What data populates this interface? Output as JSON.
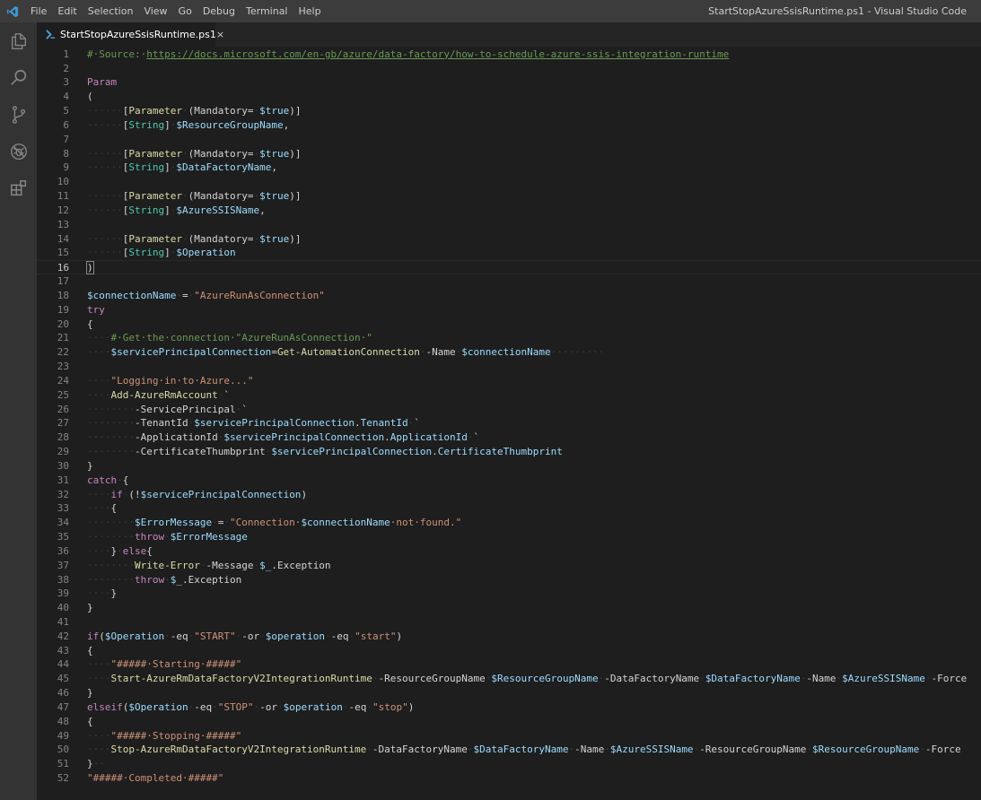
{
  "menu": [
    "File",
    "Edit",
    "Selection",
    "View",
    "Go",
    "Debug",
    "Terminal",
    "Help"
  ],
  "window_title": "StartStopAzureSsisRuntime.ps1 - Visual Studio Code",
  "activity_icons": [
    "explorer-icon",
    "search-icon",
    "source-control-icon",
    "debug-icon",
    "extensions-icon"
  ],
  "tab": {
    "label": "StartStopAzureSsisRuntime.ps1",
    "close": "×"
  },
  "current_line": 16,
  "lines": [
    {
      "n": "1",
      "t": [
        [
          "c-comment",
          "#·Source:·"
        ],
        [
          "c-link",
          "https://docs.microsoft.com/en-gb/azure/data-factory/how-to-schedule-azure-ssis-integration-runtime"
        ]
      ]
    },
    {
      "n": "2",
      "t": []
    },
    {
      "n": "3",
      "t": [
        [
          "c-kw",
          "Param"
        ]
      ]
    },
    {
      "n": "4",
      "t": [
        [
          "c-punc",
          "("
        ]
      ]
    },
    {
      "n": "5",
      "t": [
        [
          "ws",
          "······"
        ],
        [
          "c-punc",
          "["
        ],
        [
          "c-attr",
          "Parameter"
        ],
        [
          "ws",
          "·"
        ],
        [
          "c-punc",
          "("
        ],
        [
          "c-param",
          "Mandatory="
        ],
        [
          "ws",
          "·"
        ],
        [
          "c-var",
          "$true"
        ],
        [
          "c-punc",
          ")]"
        ]
      ]
    },
    {
      "n": "6",
      "t": [
        [
          "ws",
          "······"
        ],
        [
          "c-punc",
          "["
        ],
        [
          "c-type",
          "String"
        ],
        [
          "c-punc",
          "]"
        ],
        [
          "ws",
          "·"
        ],
        [
          "c-var",
          "$ResourceGroupName"
        ],
        [
          "c-punc",
          ","
        ]
      ]
    },
    {
      "n": "7",
      "t": []
    },
    {
      "n": "8",
      "t": [
        [
          "ws",
          "······"
        ],
        [
          "c-punc",
          "["
        ],
        [
          "c-attr",
          "Parameter"
        ],
        [
          "ws",
          "·"
        ],
        [
          "c-punc",
          "("
        ],
        [
          "c-param",
          "Mandatory="
        ],
        [
          "ws",
          "·"
        ],
        [
          "c-var",
          "$true"
        ],
        [
          "c-punc",
          ")]"
        ]
      ]
    },
    {
      "n": "9",
      "t": [
        [
          "ws",
          "······"
        ],
        [
          "c-punc",
          "["
        ],
        [
          "c-type",
          "String"
        ],
        [
          "c-punc",
          "]"
        ],
        [
          "ws",
          "·"
        ],
        [
          "c-var",
          "$DataFactoryName"
        ],
        [
          "c-punc",
          ","
        ]
      ]
    },
    {
      "n": "10",
      "t": []
    },
    {
      "n": "11",
      "t": [
        [
          "ws",
          "······"
        ],
        [
          "c-punc",
          "["
        ],
        [
          "c-attr",
          "Parameter"
        ],
        [
          "ws",
          "·"
        ],
        [
          "c-punc",
          "("
        ],
        [
          "c-param",
          "Mandatory="
        ],
        [
          "ws",
          "·"
        ],
        [
          "c-var",
          "$true"
        ],
        [
          "c-punc",
          ")]"
        ]
      ]
    },
    {
      "n": "12",
      "t": [
        [
          "ws",
          "······"
        ],
        [
          "c-punc",
          "["
        ],
        [
          "c-type",
          "String"
        ],
        [
          "c-punc",
          "]"
        ],
        [
          "ws",
          "·"
        ],
        [
          "c-var",
          "$AzureSSISName"
        ],
        [
          "c-punc",
          ","
        ]
      ]
    },
    {
      "n": "13",
      "t": []
    },
    {
      "n": "14",
      "t": [
        [
          "ws",
          "······"
        ],
        [
          "c-punc",
          "["
        ],
        [
          "c-attr",
          "Parameter"
        ],
        [
          "ws",
          "·"
        ],
        [
          "c-punc",
          "("
        ],
        [
          "c-param",
          "Mandatory="
        ],
        [
          "ws",
          "·"
        ],
        [
          "c-var",
          "$true"
        ],
        [
          "c-punc",
          ")]"
        ]
      ]
    },
    {
      "n": "15",
      "t": [
        [
          "ws",
          "······"
        ],
        [
          "c-punc",
          "["
        ],
        [
          "c-type",
          "String"
        ],
        [
          "c-punc",
          "]"
        ],
        [
          "ws",
          "·"
        ],
        [
          "c-var",
          "$Operation"
        ]
      ]
    },
    {
      "n": "16",
      "t": [
        [
          "c-punc bracket-match",
          ")"
        ]
      ]
    },
    {
      "n": "17",
      "t": []
    },
    {
      "n": "18",
      "t": [
        [
          "c-var",
          "$connectionName"
        ],
        [
          "ws",
          "·"
        ],
        [
          "c-punc",
          "="
        ],
        [
          "ws",
          "·"
        ],
        [
          "c-str",
          "\"AzureRunAsConnection\""
        ]
      ]
    },
    {
      "n": "19",
      "t": [
        [
          "c-kw",
          "try"
        ]
      ]
    },
    {
      "n": "20",
      "t": [
        [
          "c-punc",
          "{"
        ]
      ]
    },
    {
      "n": "21",
      "t": [
        [
          "ws",
          "····"
        ],
        [
          "c-comment",
          "#·Get·the·connection·\"AzureRunAsConnection·\""
        ]
      ]
    },
    {
      "n": "22",
      "t": [
        [
          "ws",
          "····"
        ],
        [
          "c-var",
          "$servicePrincipalConnection"
        ],
        [
          "c-punc",
          "="
        ],
        [
          "c-cmd",
          "Get-AutomationConnection"
        ],
        [
          "ws",
          "·"
        ],
        [
          "c-param",
          "-Name"
        ],
        [
          "ws",
          "·"
        ],
        [
          "c-var",
          "$connectionName"
        ],
        [
          "ws",
          "·········"
        ]
      ]
    },
    {
      "n": "23",
      "t": []
    },
    {
      "n": "24",
      "t": [
        [
          "ws",
          "····"
        ],
        [
          "c-str",
          "\"Logging·in·to·Azure...\""
        ]
      ]
    },
    {
      "n": "25",
      "t": [
        [
          "ws",
          "····"
        ],
        [
          "c-cmd",
          "Add-AzureRmAccount"
        ],
        [
          "ws",
          "·"
        ],
        [
          "c-punc",
          "`"
        ]
      ]
    },
    {
      "n": "26",
      "t": [
        [
          "ws",
          "········"
        ],
        [
          "c-param",
          "-ServicePrincipal"
        ],
        [
          "ws",
          "·"
        ],
        [
          "c-punc",
          "`"
        ]
      ]
    },
    {
      "n": "27",
      "t": [
        [
          "ws",
          "········"
        ],
        [
          "c-param",
          "-TenantId"
        ],
        [
          "ws",
          "·"
        ],
        [
          "c-var",
          "$servicePrincipalConnection"
        ],
        [
          "c-punc",
          "."
        ],
        [
          "c-var",
          "TenantId"
        ],
        [
          "ws",
          "·"
        ],
        [
          "c-punc",
          "`"
        ]
      ]
    },
    {
      "n": "28",
      "t": [
        [
          "ws",
          "········"
        ],
        [
          "c-param",
          "-ApplicationId"
        ],
        [
          "ws",
          "·"
        ],
        [
          "c-var",
          "$servicePrincipalConnection"
        ],
        [
          "c-punc",
          "."
        ],
        [
          "c-var",
          "ApplicationId"
        ],
        [
          "ws",
          "·"
        ],
        [
          "c-punc",
          "`"
        ]
      ]
    },
    {
      "n": "29",
      "t": [
        [
          "ws",
          "········"
        ],
        [
          "c-param",
          "-CertificateThumbprint"
        ],
        [
          "ws",
          "·"
        ],
        [
          "c-var",
          "$servicePrincipalConnection"
        ],
        [
          "c-punc",
          "."
        ],
        [
          "c-var",
          "CertificateThumbprint"
        ]
      ]
    },
    {
      "n": "30",
      "t": [
        [
          "c-punc",
          "}"
        ]
      ]
    },
    {
      "n": "31",
      "t": [
        [
          "c-kw",
          "catch"
        ],
        [
          "ws",
          "·"
        ],
        [
          "c-punc",
          "{"
        ]
      ]
    },
    {
      "n": "32",
      "t": [
        [
          "ws",
          "····"
        ],
        [
          "c-kw",
          "if"
        ],
        [
          "ws",
          "·"
        ],
        [
          "c-punc",
          "(!"
        ],
        [
          "c-var",
          "$servicePrincipalConnection"
        ],
        [
          "c-punc",
          ")"
        ]
      ]
    },
    {
      "n": "33",
      "t": [
        [
          "ws",
          "····"
        ],
        [
          "c-punc",
          "{"
        ]
      ]
    },
    {
      "n": "34",
      "t": [
        [
          "ws",
          "········"
        ],
        [
          "c-var",
          "$ErrorMessage"
        ],
        [
          "ws",
          "·"
        ],
        [
          "c-punc",
          "="
        ],
        [
          "ws",
          "·"
        ],
        [
          "c-str",
          "\"Connection·"
        ],
        [
          "c-var",
          "$connectionName"
        ],
        [
          "c-str",
          "·not·found.\""
        ]
      ]
    },
    {
      "n": "35",
      "t": [
        [
          "ws",
          "········"
        ],
        [
          "c-kw",
          "throw"
        ],
        [
          "ws",
          "·"
        ],
        [
          "c-var",
          "$ErrorMessage"
        ]
      ]
    },
    {
      "n": "36",
      "t": [
        [
          "ws",
          "····"
        ],
        [
          "c-punc",
          "}"
        ],
        [
          "ws",
          "·"
        ],
        [
          "c-kw",
          "else"
        ],
        [
          "c-punc",
          "{"
        ]
      ]
    },
    {
      "n": "37",
      "t": [
        [
          "ws",
          "········"
        ],
        [
          "c-cmd",
          "Write-Error"
        ],
        [
          "ws",
          "·"
        ],
        [
          "c-param",
          "-Message"
        ],
        [
          "ws",
          "·"
        ],
        [
          "c-var",
          "$_"
        ],
        [
          "c-punc",
          "."
        ],
        [
          "c-param",
          "Exception"
        ]
      ]
    },
    {
      "n": "38",
      "t": [
        [
          "ws",
          "········"
        ],
        [
          "c-kw",
          "throw"
        ],
        [
          "ws",
          "·"
        ],
        [
          "c-var",
          "$_"
        ],
        [
          "c-punc",
          "."
        ],
        [
          "c-param",
          "Exception"
        ]
      ]
    },
    {
      "n": "39",
      "t": [
        [
          "ws",
          "····"
        ],
        [
          "c-punc",
          "}"
        ]
      ]
    },
    {
      "n": "40",
      "t": [
        [
          "c-punc",
          "}"
        ]
      ]
    },
    {
      "n": "41",
      "t": []
    },
    {
      "n": "42",
      "t": [
        [
          "c-kw",
          "if"
        ],
        [
          "c-punc",
          "("
        ],
        [
          "c-var",
          "$Operation"
        ],
        [
          "ws",
          "·"
        ],
        [
          "c-param",
          "-eq"
        ],
        [
          "ws",
          "·"
        ],
        [
          "c-str",
          "\"START\""
        ],
        [
          "ws",
          "·"
        ],
        [
          "c-param",
          "-or"
        ],
        [
          "ws",
          "·"
        ],
        [
          "c-var",
          "$operation"
        ],
        [
          "ws",
          "·"
        ],
        [
          "c-param",
          "-eq"
        ],
        [
          "ws",
          "·"
        ],
        [
          "c-str",
          "\"start\""
        ],
        [
          "c-punc",
          ")"
        ]
      ]
    },
    {
      "n": "43",
      "t": [
        [
          "c-punc",
          "{"
        ]
      ]
    },
    {
      "n": "44",
      "t": [
        [
          "ws",
          "····"
        ],
        [
          "c-str",
          "\"#####·Starting·#####\""
        ]
      ]
    },
    {
      "n": "45",
      "t": [
        [
          "ws",
          "····"
        ],
        [
          "c-cmd",
          "Start-AzureRmDataFactoryV2IntegrationRuntime"
        ],
        [
          "ws",
          "·"
        ],
        [
          "c-param",
          "-ResourceGroupName"
        ],
        [
          "ws",
          "·"
        ],
        [
          "c-var",
          "$ResourceGroupName"
        ],
        [
          "ws",
          "·"
        ],
        [
          "c-param",
          "-DataFactoryName"
        ],
        [
          "ws",
          "·"
        ],
        [
          "c-var",
          "$DataFactoryName"
        ],
        [
          "ws",
          "·"
        ],
        [
          "c-param",
          "-Name"
        ],
        [
          "ws",
          "·"
        ],
        [
          "c-var",
          "$AzureSSISName"
        ],
        [
          "ws",
          "·"
        ],
        [
          "c-param",
          "-Force"
        ]
      ]
    },
    {
      "n": "46",
      "t": [
        [
          "c-punc",
          "}"
        ]
      ]
    },
    {
      "n": "47",
      "t": [
        [
          "c-kw",
          "elseif"
        ],
        [
          "c-punc",
          "("
        ],
        [
          "c-var",
          "$Operation"
        ],
        [
          "ws",
          "·"
        ],
        [
          "c-param",
          "-eq"
        ],
        [
          "ws",
          "·"
        ],
        [
          "c-str",
          "\"STOP\""
        ],
        [
          "ws",
          "·"
        ],
        [
          "c-param",
          "-or"
        ],
        [
          "ws",
          "·"
        ],
        [
          "c-var",
          "$operation"
        ],
        [
          "ws",
          "·"
        ],
        [
          "c-param",
          "-eq"
        ],
        [
          "ws",
          "·"
        ],
        [
          "c-str",
          "\"stop\""
        ],
        [
          "c-punc",
          ")"
        ]
      ]
    },
    {
      "n": "48",
      "t": [
        [
          "c-punc",
          "{"
        ]
      ]
    },
    {
      "n": "49",
      "t": [
        [
          "ws",
          "····"
        ],
        [
          "c-str",
          "\"#####·Stopping·#####\""
        ]
      ]
    },
    {
      "n": "50",
      "t": [
        [
          "ws",
          "····"
        ],
        [
          "c-cmd",
          "Stop-AzureRmDataFactoryV2IntegrationRuntime"
        ],
        [
          "ws",
          "·"
        ],
        [
          "c-param",
          "-DataFactoryName"
        ],
        [
          "ws",
          "·"
        ],
        [
          "c-var",
          "$DataFactoryName"
        ],
        [
          "ws",
          "·"
        ],
        [
          "c-param",
          "-Name"
        ],
        [
          "ws",
          "·"
        ],
        [
          "c-var",
          "$AzureSSISName"
        ],
        [
          "ws",
          "·"
        ],
        [
          "c-param",
          "-ResourceGroupName"
        ],
        [
          "ws",
          "·"
        ],
        [
          "c-var",
          "$ResourceGroupName"
        ],
        [
          "ws",
          "·"
        ],
        [
          "c-param",
          "-Force"
        ]
      ]
    },
    {
      "n": "51",
      "t": [
        [
          "c-punc",
          "}"
        ],
        [
          "ws",
          "··"
        ]
      ]
    },
    {
      "n": "52",
      "t": [
        [
          "c-str",
          "\"#####·Completed·#####\""
        ]
      ]
    }
  ]
}
